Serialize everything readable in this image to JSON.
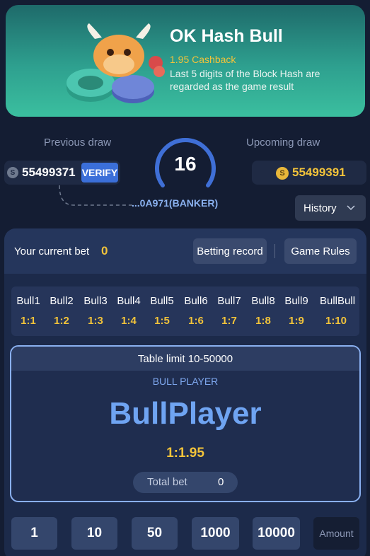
{
  "banner": {
    "title": "OK Hash Bull",
    "cashback": "1.95 Cashback",
    "description": "Last 5 digits of the Block Hash are regarded as the game result"
  },
  "draw": {
    "previous_label": "Previous draw",
    "previous_number": "55499371",
    "verify_label": "VERIFY",
    "hash_result": "...0A971(BANKER)",
    "countdown": "16",
    "upcoming_label": "Upcoming draw",
    "upcoming_number": "55499391",
    "history_label": "History"
  },
  "bet": {
    "current_bet_label": "Your current bet",
    "current_bet_value": "0",
    "betting_record_label": "Betting record",
    "game_rules_label": "Game Rules"
  },
  "odds": [
    {
      "name": "Bull1",
      "value": "1:1"
    },
    {
      "name": "Bull2",
      "value": "1:2"
    },
    {
      "name": "Bull3",
      "value": "1:3"
    },
    {
      "name": "Bull4",
      "value": "1:4"
    },
    {
      "name": "Bull5",
      "value": "1:5"
    },
    {
      "name": "Bull6",
      "value": "1:6"
    },
    {
      "name": "Bull7",
      "value": "1:7"
    },
    {
      "name": "Bull8",
      "value": "1:8"
    },
    {
      "name": "Bull9",
      "value": "1:9"
    },
    {
      "name": "BullBull",
      "value": "1:10"
    }
  ],
  "player_card": {
    "table_limit": "Table limit 10-50000",
    "subtitle": "BULL PLAYER",
    "title": "BullPlayer",
    "odds": "1:1.95",
    "total_bet_label": "Total bet",
    "total_bet_value": "0"
  },
  "chips": [
    "1",
    "10",
    "50",
    "1000",
    "10000"
  ],
  "amount_label": "Amount",
  "colors": {
    "background": "#141d33",
    "accent_gold": "#f2c33a",
    "accent_blue": "#6fa4f2",
    "verify_blue": "#3b6fd9"
  }
}
